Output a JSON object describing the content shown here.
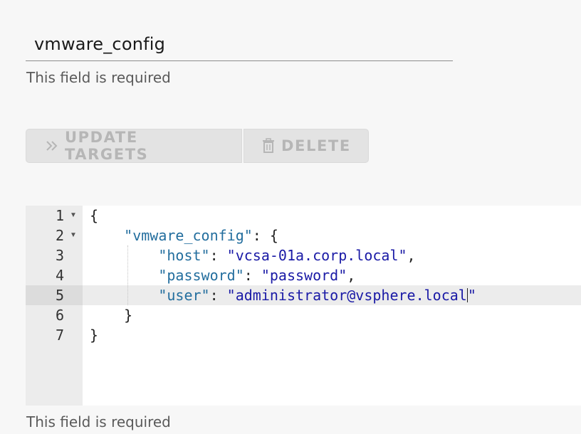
{
  "name_field": {
    "value": "vmware_config",
    "helper": "This field is required"
  },
  "actions": {
    "update_targets_label": "UPDATE TARGETS",
    "delete_label": "DELETE",
    "update_icon": "double-chevron-right-icon",
    "delete_icon": "trash-icon"
  },
  "editor": {
    "line_numbers": [
      "1",
      "2",
      "3",
      "4",
      "5",
      "6",
      "7"
    ],
    "active_line": 5,
    "lines": {
      "l1": "{",
      "l2_key": "\"vmware_config\"",
      "l2_rest": ": {",
      "l3_key": "\"host\"",
      "l3_sep": ": ",
      "l3_val": "\"vcsa-01a.corp.local\"",
      "l3_end": ",",
      "l4_key": "\"password\"",
      "l4_sep": ": ",
      "l4_val": "\"password\"",
      "l4_end": ",",
      "l5_key": "\"user\"",
      "l5_sep": ": ",
      "l5_val_a": "\"administrator@vsphere.local",
      "l5_val_b": "\"",
      "l6": "}",
      "l7": "}"
    },
    "helper": "This field is required"
  },
  "colors": {
    "json_key": "#236e9e",
    "json_string": "#1a1aa6",
    "disabled_button_text": "#b6b6b6"
  }
}
